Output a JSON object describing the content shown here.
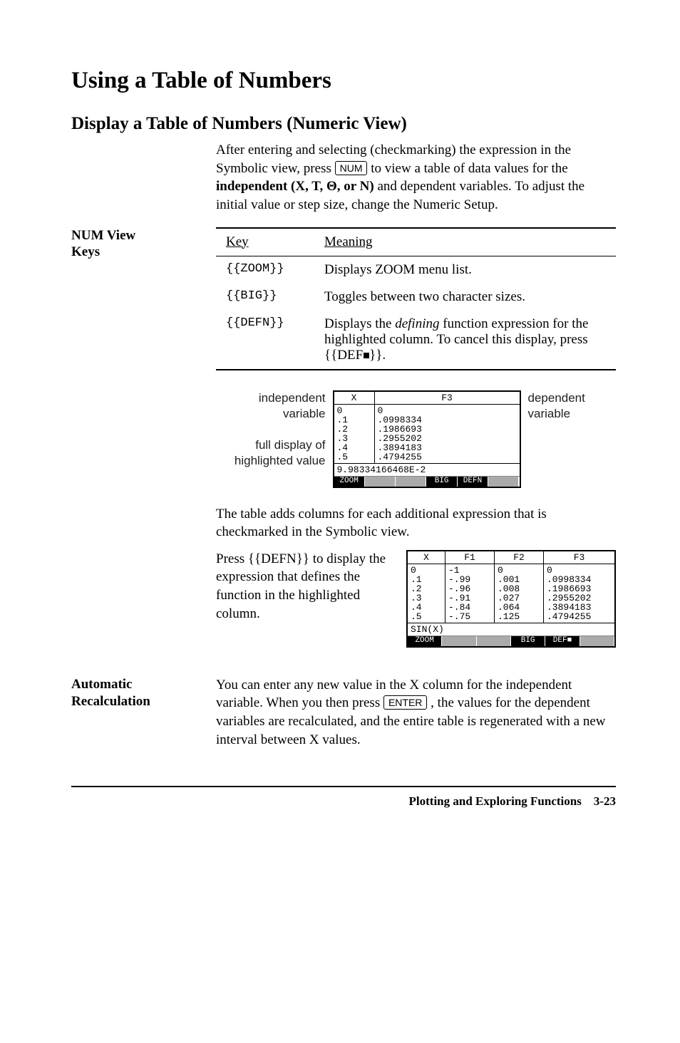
{
  "h1": "Using a Table of Numbers",
  "h2": "Display a Table of Numbers (Numeric View)",
  "intro": {
    "pre": "After entering and selecting (checkmarking) the expression in the Symbolic view, press ",
    "key": "NUM",
    "mid": " to view a table of data values for the ",
    "boldvars": "independent (X, T, Θ, or N)",
    "post": " and dependent variables. To adjust the initial value or step size, change the Numeric Setup."
  },
  "numview": {
    "label1": "NUM View",
    "label2": "Keys",
    "headers": {
      "key": "Key",
      "meaning": "Meaning"
    },
    "rows": [
      {
        "key": "{{ZOOM}}",
        "meaning": "Displays ZOOM menu list."
      },
      {
        "key": "{{BIG}}",
        "meaning": "Toggles between two character sizes."
      },
      {
        "key": "{{DEFN}}",
        "meaning_pre": "Displays the ",
        "meaning_em": "defining",
        "meaning_post": " function expression for the highlighted column. To cancel this display, press {{DEF",
        "meaning_tail": "}}."
      }
    ]
  },
  "screen1": {
    "left_annot1": "independent variable",
    "left_annot2": "full display of highlighted value",
    "right_annot": "dependent variable",
    "cols": [
      "X",
      "F3"
    ],
    "xvals": [
      "0",
      ".1",
      ".2",
      ".3",
      ".4",
      ".5"
    ],
    "f3vals": [
      "0",
      ".0998334",
      ".1986693",
      ".2955202",
      ".3894183",
      ".4794255"
    ],
    "highlight_row": 1,
    "status": "9.98334166468E-2",
    "menu": [
      "ZOOM",
      "",
      "",
      "BIG",
      "DEFN",
      ""
    ]
  },
  "post_screen1": "The table adds columns for each additional expression that is checkmarked in the Symbolic view.",
  "defn_para": "Press {{DEFN}} to display the expression that defines the function in the highlighted column.",
  "screen2": {
    "cols": [
      "X",
      "F1",
      "F2",
      "F3"
    ],
    "xvals": [
      "0",
      ".1",
      ".2",
      ".3",
      ".4",
      ".5"
    ],
    "f1vals": [
      "-1",
      "-.99",
      "-.96",
      "-.91",
      "-.84",
      "-.75"
    ],
    "f2vals": [
      "0",
      ".001",
      ".008",
      ".027",
      ".064",
      ".125"
    ],
    "f3vals": [
      "0",
      ".0998334",
      ".1986693",
      ".2955202",
      ".3894183",
      ".4794255"
    ],
    "highlight_col": 3,
    "highlight_row": 1,
    "status": "SIN(X)",
    "menu": [
      "ZOOM",
      "",
      "",
      "BIG",
      "DEF■",
      ""
    ]
  },
  "auto": {
    "label1": "Automatic",
    "label2": "Recalculation",
    "pre": "You can enter any new value in the X column for the independent variable. When you then press ",
    "key": "ENTER",
    "post": ", the values for the dependent variables are recalculated, and the entire table is regenerated with a new interval between X values."
  },
  "footer": {
    "title": "Plotting and Exploring Functions",
    "page": "3-23"
  }
}
